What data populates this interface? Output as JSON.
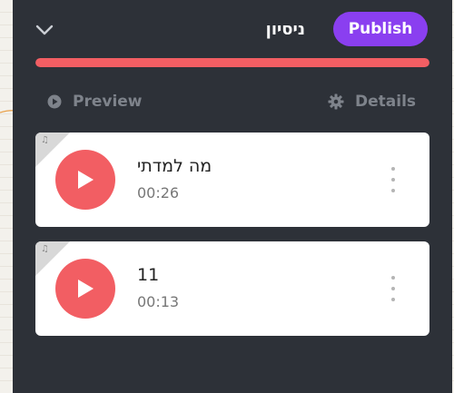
{
  "header": {
    "title": "ניסיון",
    "publish_label": "Publish",
    "collapse_icon": "chevron-down-icon"
  },
  "progress": {
    "fraction": 1.0,
    "color": "#f25e63"
  },
  "subnav": {
    "preview_label": "Preview",
    "preview_icon": "play-circle-icon",
    "details_label": "Details",
    "details_icon": "gear-icon"
  },
  "tracks": [
    {
      "title": "מה למדתי",
      "duration": "00:26"
    },
    {
      "title": "11",
      "duration": "00:13"
    }
  ],
  "colors": {
    "panel_bg": "#2d3138",
    "accent_purple": "#8a3ff0",
    "accent_red": "#f25e63",
    "card_bg": "#ffffff"
  }
}
